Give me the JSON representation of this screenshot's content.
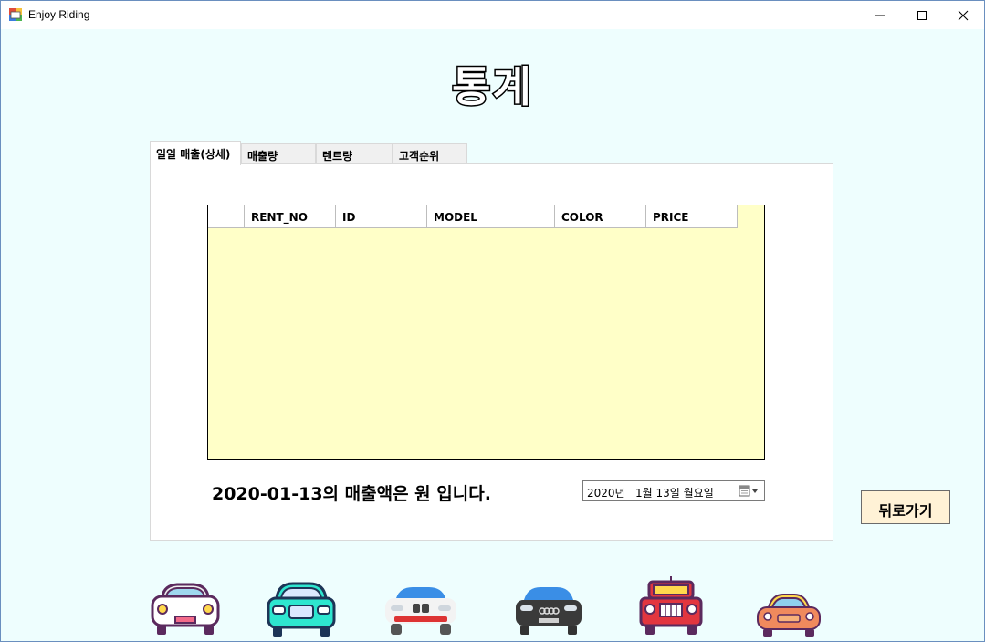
{
  "window": {
    "title": "Enjoy Riding"
  },
  "heading": "통계",
  "tabs": [
    {
      "label": "일일 매출(상세)",
      "active": true
    },
    {
      "label": "매출량",
      "active": false
    },
    {
      "label": "렌트량",
      "active": false
    },
    {
      "label": "고객순위",
      "active": false
    }
  ],
  "grid": {
    "columns": [
      "",
      "RENT_NO",
      "ID",
      "MODEL",
      "COLOR",
      "PRICE"
    ],
    "rows": []
  },
  "sales_text": "2020-01-13의 매출액은 원 입니다.",
  "date_picker": {
    "value": "2020년   1월 13일 월요일"
  },
  "back_button": "뒤로가기",
  "colors": {
    "background": "#eefefe",
    "grid_background": "#ffffc8",
    "back_button_bg": "#fff2d6"
  },
  "cars": [
    {
      "icon": "white-car-icon",
      "color": "#ffffff"
    },
    {
      "icon": "teal-car-icon",
      "color": "#2ee6cf"
    },
    {
      "icon": "white-blue-car-icon",
      "color": "#f1f1f1"
    },
    {
      "icon": "black-car-icon",
      "color": "#3a3a3a"
    },
    {
      "icon": "red-jeep-icon",
      "color": "#e2363f"
    },
    {
      "icon": "orange-car-icon",
      "color": "#f08a5d"
    }
  ]
}
